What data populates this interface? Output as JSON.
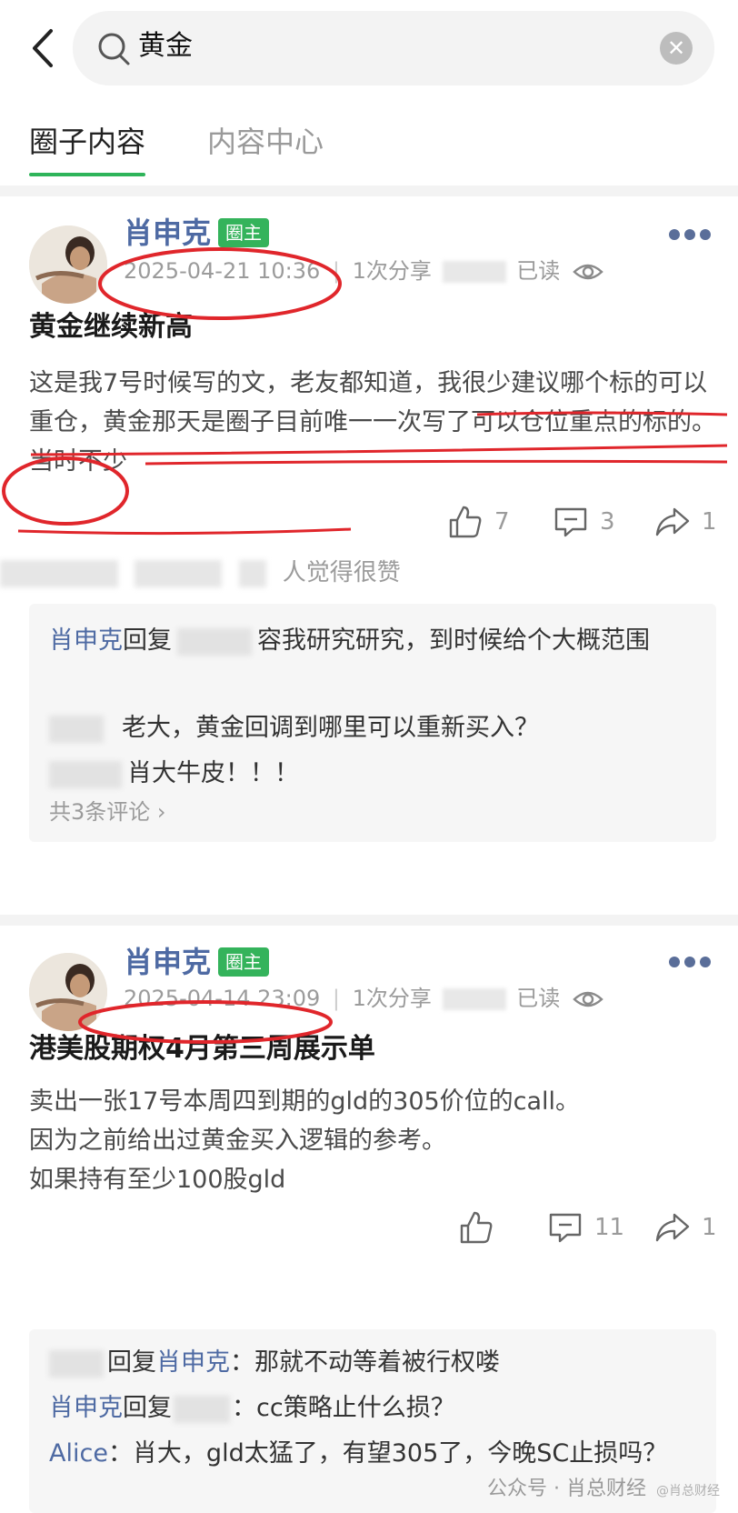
{
  "search": {
    "query": "黄金",
    "clear_glyph": "✕"
  },
  "tabs": [
    {
      "label": "圈子内容"
    },
    {
      "label": "内容中心"
    }
  ],
  "posts": [
    {
      "author": "肖申克",
      "badge": "圈主",
      "datetime": "2025-04-21 10:36",
      "shares": "1次分享",
      "read": "已读",
      "title": "黄金继续新高",
      "body": "这是我7号时候写的文，老友都知道，我很少建议哪个标的可以重仓，黄金那天是圈子目前唯一一次写了可以仓位重点的标的。当时不少",
      "likes": "7",
      "comments_count": "3",
      "share_count": "1",
      "likers_suffix": "人觉得很赞",
      "comments": [
        {
          "who": "肖申克",
          "mid": "回复",
          "text": "容我研究研究，到时候给个大概范围"
        },
        {
          "who": "",
          "mid": "",
          "text": "老大，黄金回调到哪里可以重新买入？"
        },
        {
          "who": "",
          "mid": "",
          "text": "肖大牛皮！！！"
        }
      ],
      "all_comments": "共3条评论 ›"
    },
    {
      "author": "肖申克",
      "badge": "圈主",
      "datetime": "2025-04-14 23:09",
      "shares": "1次分享",
      "read": "已读",
      "title": "港美股期权4月第三周展示单",
      "body_lines": [
        "卖出一张17号本周四到期的gld的305价位的call。",
        "因为之前给出过黄金买入逻辑的参考。",
        "如果持有至少100股gld"
      ],
      "likes": "",
      "comments_count": "11",
      "share_count": "1",
      "comments": [
        {
          "who": "肖申克",
          "pre": "回复",
          "text": "：那就不动等着被行权喽"
        },
        {
          "who": "肖申克",
          "mid": "回复",
          "text": "：cc策略止什么损？"
        },
        {
          "who": "Alice",
          "text": "：肖大，gld太猛了，有望305了，今晚SC止损吗？"
        }
      ]
    }
  ],
  "watermark": {
    "text": "公众号 · 肖总财经",
    "small": "@肖总财经"
  },
  "colors": {
    "accent": "#2fb45a",
    "author": "#4e6aa3",
    "annotation": "#e0262b"
  }
}
